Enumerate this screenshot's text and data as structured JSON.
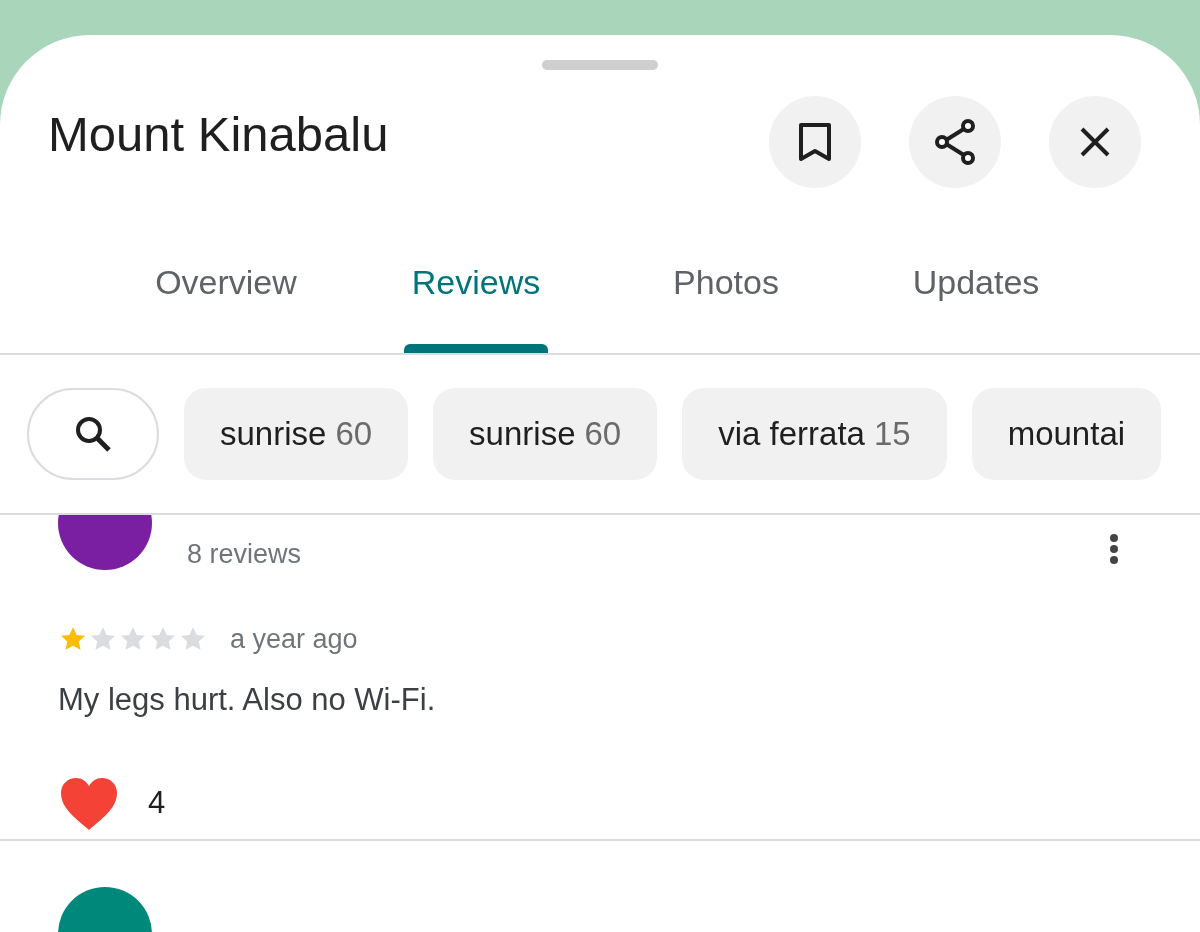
{
  "place": {
    "title": "Mount Kinabalu"
  },
  "tabs": [
    {
      "label": "Overview",
      "selected": false
    },
    {
      "label": "Reviews",
      "selected": true
    },
    {
      "label": "Photos",
      "selected": false
    },
    {
      "label": "Updates",
      "selected": false
    }
  ],
  "topic_chips": [
    {
      "label": "sunrise",
      "count": "60"
    },
    {
      "label": "sunrise",
      "count": "60"
    },
    {
      "label": "via ferrata",
      "count": "15"
    },
    {
      "label": "mountai"
    }
  ],
  "reviews": [
    {
      "color": "#7b1fa2",
      "review_count": "8 reviews",
      "stars": 1,
      "time": "a year ago",
      "text": "My legs hurt. Also no Wi-Fi.",
      "reaction_count": "4"
    },
    {
      "color": "#00897b"
    }
  ]
}
